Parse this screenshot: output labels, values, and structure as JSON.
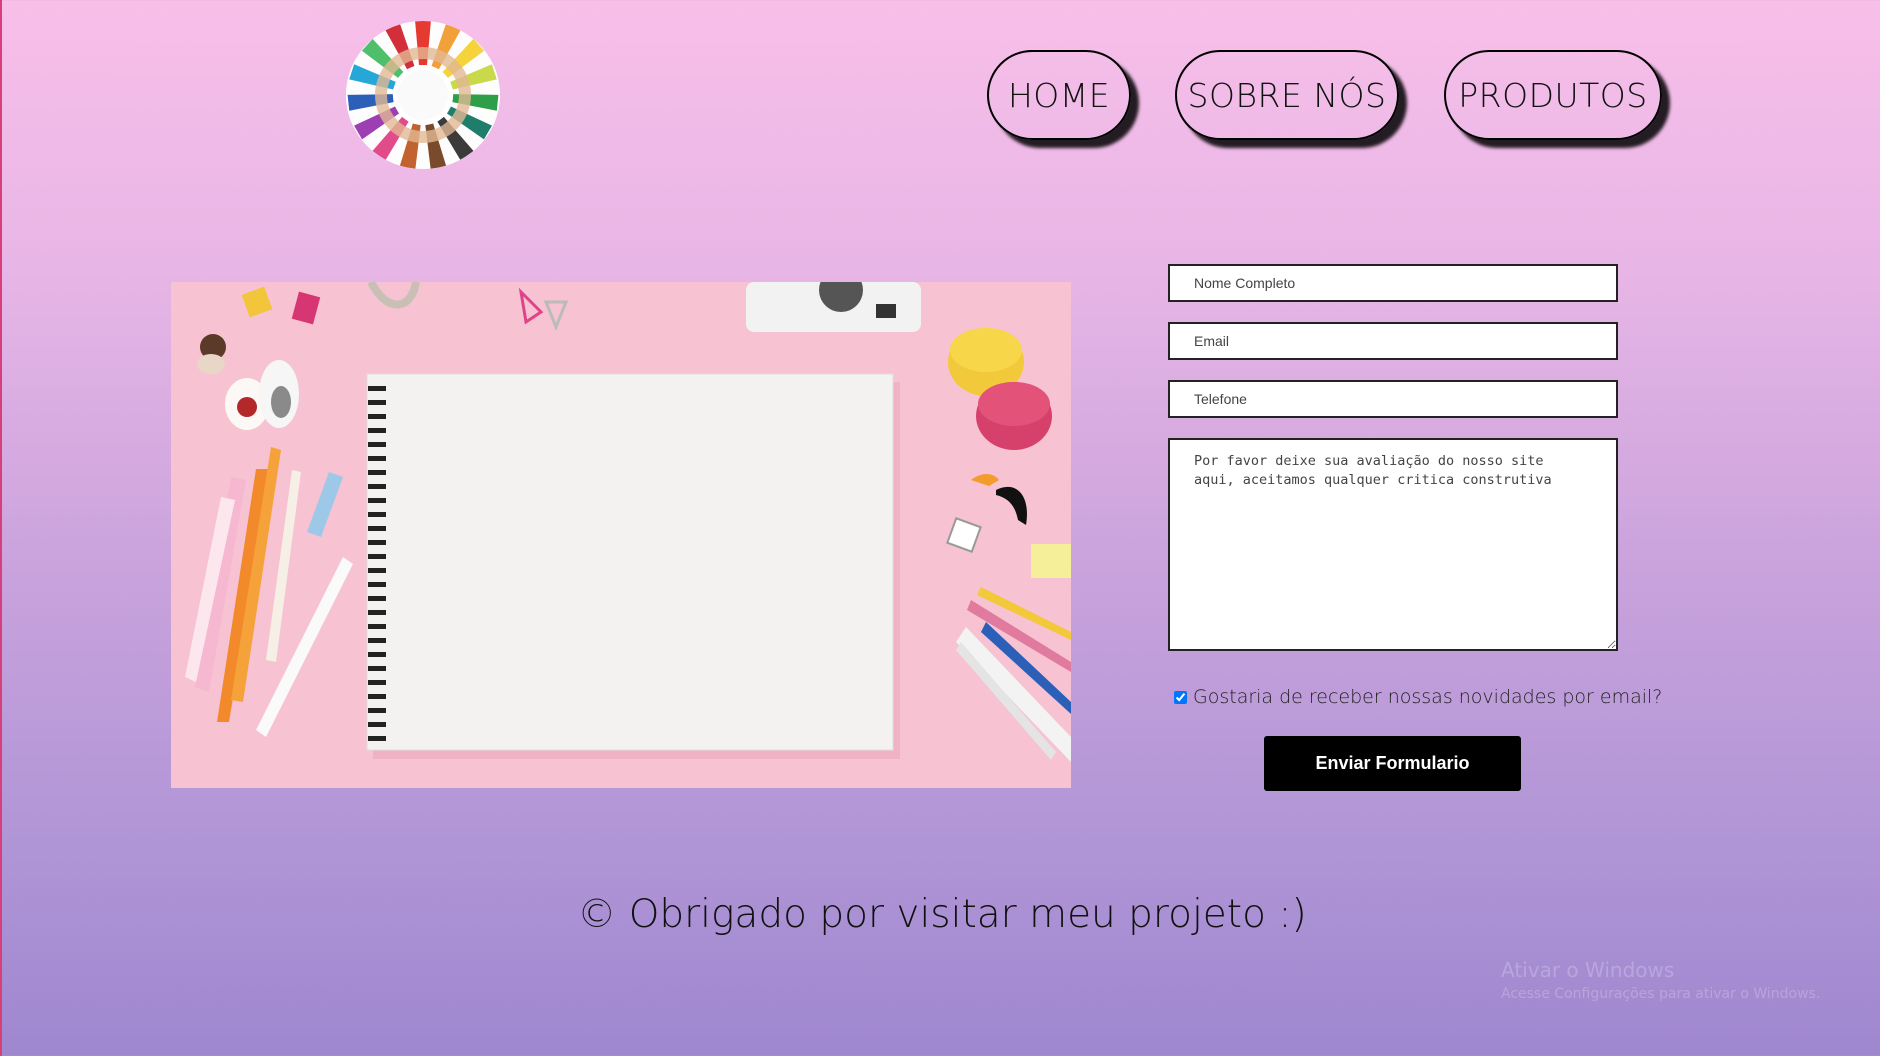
{
  "header": {
    "logo_alt": "logo",
    "nav": [
      {
        "label": "HOME"
      },
      {
        "label": "SOBRE NÓS"
      },
      {
        "label": "PRODUTOS"
      }
    ]
  },
  "hero": {
    "image_description": ""
  },
  "form": {
    "name_placeholder": "Nome Completo",
    "email_placeholder": "Email",
    "phone_placeholder": "Telefone",
    "message_placeholder": "Por favor deixe sua avaliação do nosso site aqui, aceitamos qualquer critica construtiva",
    "newsletter_label": "Gostaria de receber nossas novidades por email?",
    "newsletter_checked": true,
    "submit_label": "Enviar Formulario"
  },
  "footer": {
    "text": "© Obrigado por visitar meu projeto :)"
  },
  "watermark": {
    "title": "Ativar o Windows",
    "subtitle": "Acesse Configurações para ativar o Windows."
  },
  "colors": {
    "background_top": "#f8bfe9",
    "background_bottom": "#9f87cf",
    "button_bg": "#000000",
    "hero_bg": "#f6bfd1"
  }
}
